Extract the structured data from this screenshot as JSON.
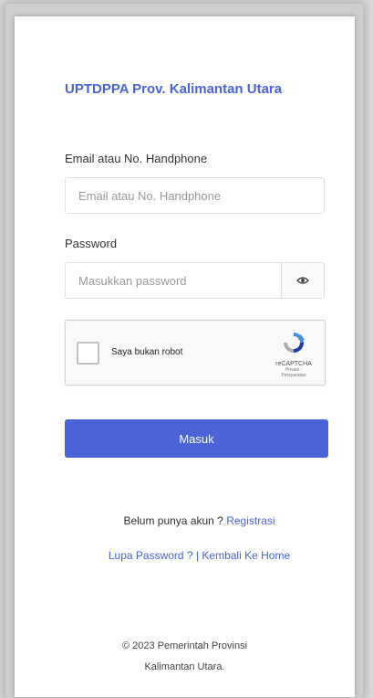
{
  "header": {
    "title": "UPTDPPA Prov. Kalimantan Utara"
  },
  "form": {
    "email_label": "Email atau No. Handphone",
    "email_placeholder": "Email atau No. Handphone",
    "password_label": "Password",
    "password_placeholder": "Masukkan password",
    "password_toggle_icon": "eye-icon",
    "recaptcha": {
      "label": "Saya bukan robot",
      "brand": "reCAPTCHA",
      "links": "Privasi - Persyaratan"
    },
    "submit_label": "Masuk"
  },
  "links": {
    "no_account_text": "Belum punya akun ? ",
    "register_label": "Registrasi",
    "forgot_password_label": "Lupa Password ?",
    "separator": " | ",
    "back_home_label": "Kembali Ke Home"
  },
  "footer": {
    "line1": "© 2023 Pemerintah Provinsi",
    "line2": "Kalimantan Utara."
  },
  "colors": {
    "accent": "#4d64d9",
    "link": "#4a63d9",
    "background": "#ffffff"
  }
}
